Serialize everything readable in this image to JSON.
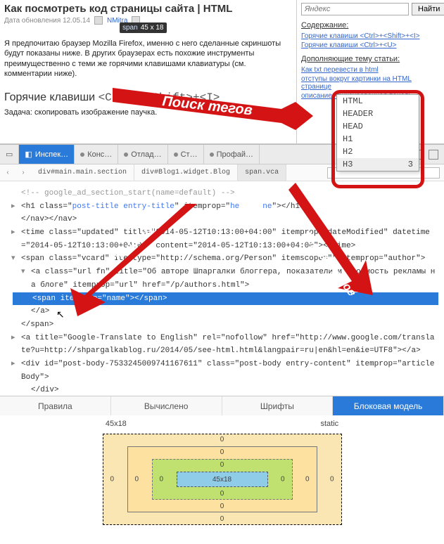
{
  "page": {
    "title": "Как посмотреть код страницы сайта | HTML",
    "date": "Дата обновления 12.05.14",
    "author": "NMitra",
    "tooltip_tag": "span",
    "tooltip_dim": "45 x 18",
    "paragraph": "Я предпочитаю браузер Mozilla Firefox, именно с него сделанные скриншоты будут показаны ниже. В других браузерах есть похожие инструменты преимущественно с теми же горячими клавишами клавиатуры (см. комментарии ниже).",
    "sub_heading_text": "Горячие клавиши",
    "sub_heading_kbd": "<Ctrl>+<Shift>+<I>",
    "task": "Задача: скопировать изображение паучка."
  },
  "sidebar": {
    "search_placeholder": "Яндекс",
    "search_button": "Найти",
    "contents_label": "Содержание:",
    "link1": "Горячие клавиши <Ctrl>+<Shift>+<I>",
    "link2": "Горячие клавиши <Ctrl>+<U>",
    "related_label": "Дополняющие тему статьи:",
    "link3": "Как txt перевести в html",
    "link4": "отступы вокруг картинки на HTML странице",
    "link5": "описание: фиксированная панель"
  },
  "annotations": {
    "arrow1": "Поиск тегов",
    "arrow2": "вложения",
    "arrow3": "дерево тегов"
  },
  "dropdown": {
    "items": [
      {
        "label": "HTML",
        "count": ""
      },
      {
        "label": "HEADER",
        "count": ""
      },
      {
        "label": "HEAD",
        "count": ""
      },
      {
        "label": "H1",
        "count": ""
      },
      {
        "label": "H2",
        "count": ""
      },
      {
        "label": "H3",
        "count": "3"
      }
    ]
  },
  "devtools": {
    "tabs": {
      "inspector": "Инспек…",
      "console": "Конс…",
      "debugger": "Отлад…",
      "style": "Ст…",
      "profiler": "Профай…"
    },
    "breadcrumb": {
      "item1": "div#main.main.section",
      "item2": "div#Blog1.widget.Blog",
      "item3": "span.vca",
      "search_value": "h"
    },
    "tree": {
      "l1": "<!-- google_ad_section_start(name=default) -->",
      "l2a": "<h1 class=\"",
      "l2b": "post-title entry-title",
      "l2c": "\" itemprop=\"",
      "l2d": "he",
      "l2e": "ne",
      "l2f": "\"></h1>",
      "l3": "</nav></nav>",
      "l4": "<time class=\"updated\" title=\"2014-05-12T10:13:00+04:00\" itemprop=\"dateModified\" datetime=\"2014-05-12T10:13:00+04:00\" content=\"2014-05-12T10:13:00+04:00\"></time>",
      "l5": "<span class=\"vcard\" itemtype=\"http://schema.org/Person\" itemscope=\"\" itemprop=\"author\">",
      "l6": "<a class=\"url fn\" title=\"Об авторе Шпаргалки блоггера, показатели и стоимость рекламы на блоге\" itemprop=\"url\" href=\"/p/authors.html\">",
      "l7": "<span itemprop=\"name\"></span>",
      "l8": "</a>",
      "l9": "</span>",
      "l10": "<a title=\"Google-Translate to English\" rel=\"nofollow\" href=\"http://www.google.com/translate?u=http://shpargalkablog.ru/2014/05/see-html.html&langpair=ru|en&hl=en&ie=UTF8\"></a>",
      "l11": "<div id=\"post-body-7533245009741167611\" class=\"post-body entry-content\" itemprop=\"articleBody\">",
      "l12": "</div>"
    }
  },
  "styles_tabs": {
    "rules": "Правила",
    "computed": "Вычислено",
    "fonts": "Шрифты",
    "box": "Блоковая модель"
  },
  "box_model": {
    "dim": "45x18",
    "position": "static",
    "content": "45x18",
    "zero": "0"
  }
}
